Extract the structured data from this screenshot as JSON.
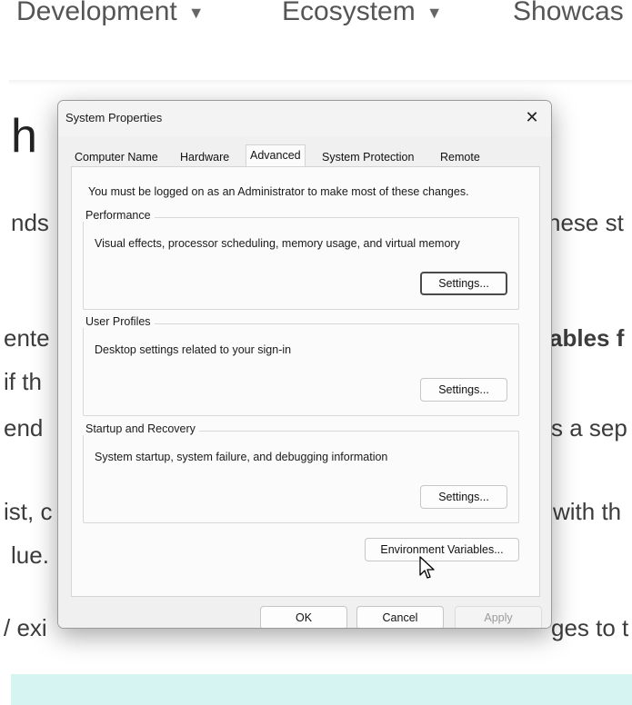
{
  "background_page": {
    "nav": [
      "Development",
      "Ecosystem",
      "Showcas"
    ],
    "heading_fragment": "h",
    "lines": [
      {
        "left": "nds",
        "right": "nese st"
      },
      {
        "left": "ente",
        "right": "ables f"
      },
      {
        "left": " if th",
        "right": ""
      },
      {
        "left": "end",
        "right": "s a sep"
      },
      {
        "left": "ist, c",
        "right": "with th"
      },
      {
        "left": "lue.",
        "right": ""
      },
      {
        "left": "/ exi",
        "right": "ges to t"
      }
    ]
  },
  "dialog": {
    "title": "System Properties",
    "close_glyph": "✕",
    "tabs": [
      "Computer Name",
      "Hardware",
      "Advanced",
      "System Protection",
      "Remote"
    ],
    "active_tab": "Advanced",
    "notice": "You must be logged on as an Administrator to make most of these changes.",
    "groups": [
      {
        "label": "Performance",
        "description": "Visual effects, processor scheduling, memory usage, and virtual memory",
        "button": "Settings..."
      },
      {
        "label": "User Profiles",
        "description": "Desktop settings related to your sign-in",
        "button": "Settings..."
      },
      {
        "label": "Startup and Recovery",
        "description": "System startup, system failure, and debugging information",
        "button": "Settings..."
      }
    ],
    "env_button": "Environment Variables...",
    "footer_buttons": {
      "ok": "OK",
      "cancel": "Cancel",
      "apply": "Apply"
    }
  },
  "colors": {
    "accent_band": "#d6f4f2",
    "dialog_bg": "#f0f0f0",
    "panel_bg": "#fbfbfb"
  },
  "icons": {
    "close": "close-icon",
    "cursor": "mouse-pointer-icon",
    "caret": "caret-down-icon"
  }
}
